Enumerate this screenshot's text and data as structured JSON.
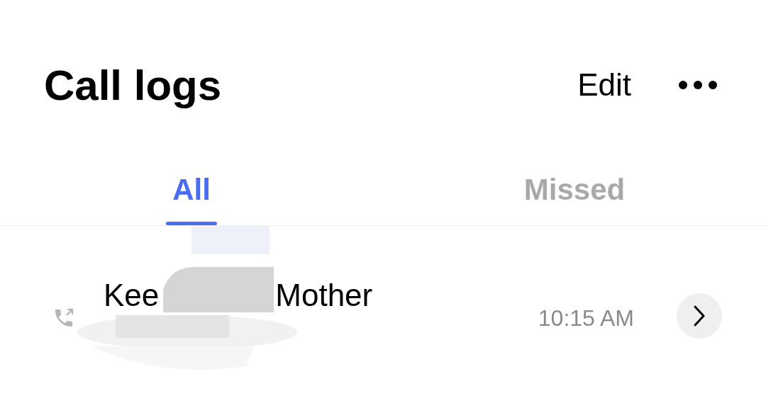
{
  "header": {
    "title": "Call logs",
    "edit": "Edit"
  },
  "tabs": [
    {
      "label": "All",
      "selected": true
    },
    {
      "label": "Missed",
      "selected": false
    }
  ],
  "calls": [
    {
      "name_parts": [
        "Kee",
        "Mother"
      ],
      "time": "10:15 AM",
      "redacted": true
    }
  ]
}
